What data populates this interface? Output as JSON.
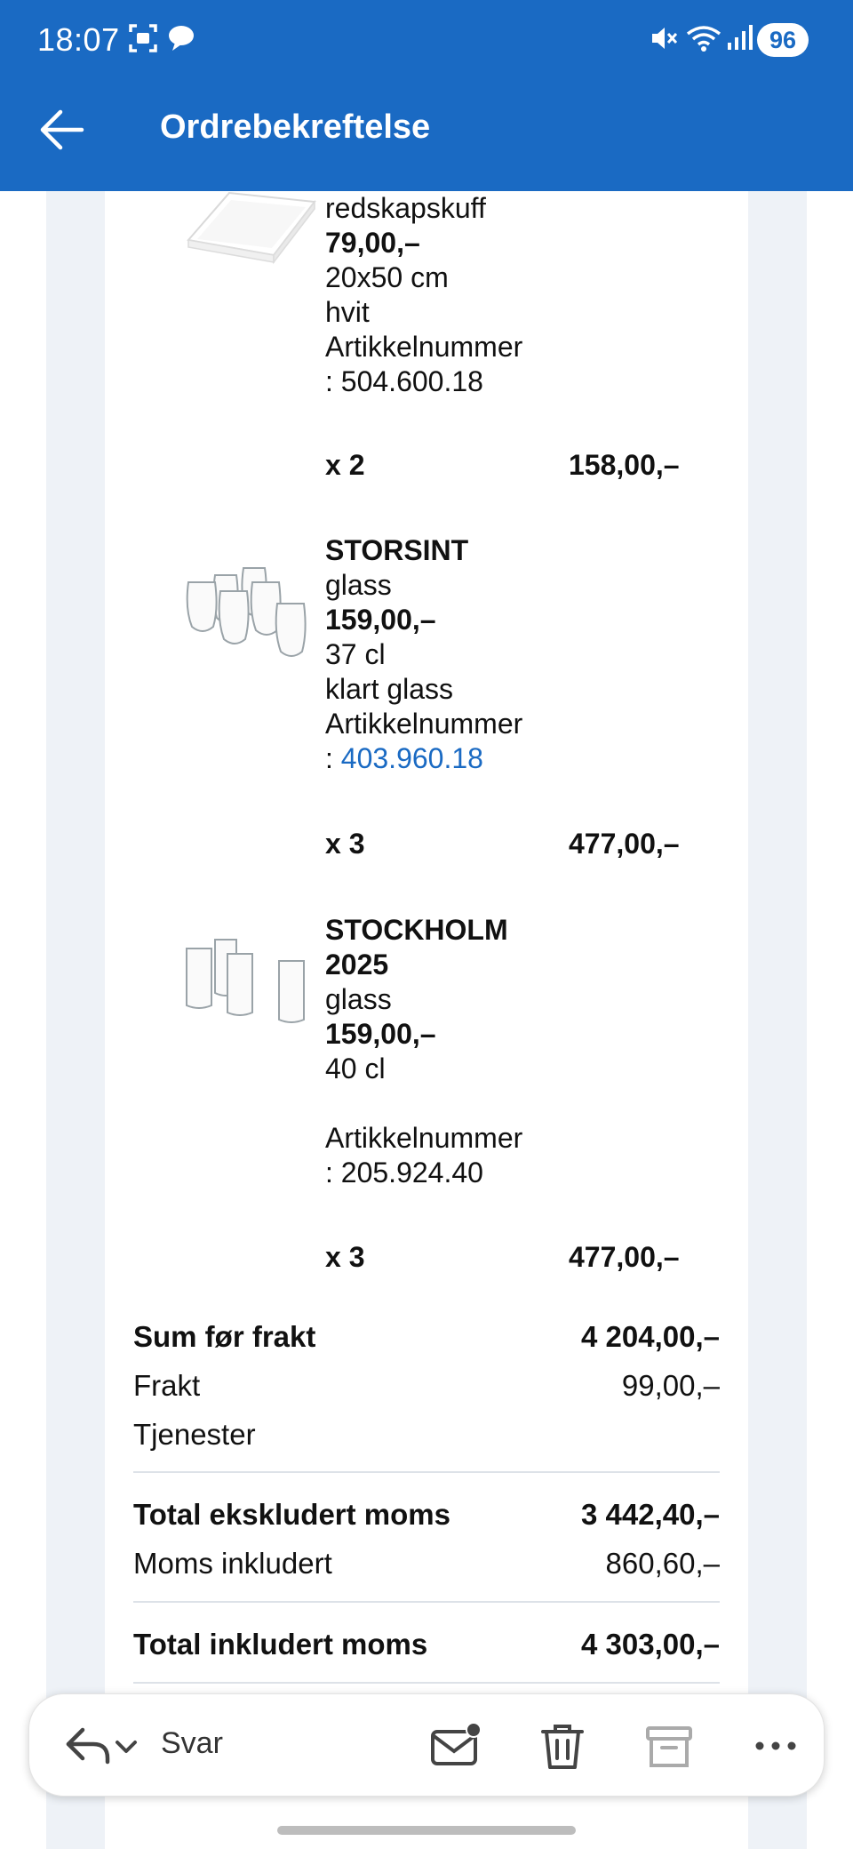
{
  "status": {
    "time": "18:07",
    "battery": "96"
  },
  "header": {
    "title": "Ordrebekreftelse"
  },
  "items": [
    {
      "name": "",
      "type": "redskapskuff",
      "price": "79,00,–",
      "spec1": "20x50 cm",
      "spec2": "hvit",
      "article_label": "Artikkelnummer",
      "article_prefix": ": ",
      "article_number": "504.600.18",
      "qty": "x 2",
      "total": "158,00,–"
    },
    {
      "name": "STORSINT",
      "type": "glass",
      "price": "159,00,–",
      "spec1": "37 cl",
      "spec2": "klart glass",
      "article_label": "Artikkelnummer",
      "article_prefix": ": ",
      "article_number": "403.960.18",
      "qty": "x 3",
      "total": "477,00,–"
    },
    {
      "name_line1": "STOCKHOLM",
      "name_line2": "2025",
      "type": "glass",
      "price": "159,00,–",
      "spec1": "40 cl",
      "article_label": "Artikkelnummer",
      "article_prefix": ": ",
      "article_number": "205.924.40",
      "qty": "x 3",
      "total": "477,00,–"
    }
  ],
  "summary": {
    "subtotal_label": "Sum før frakt",
    "subtotal_value": "4 204,00,–",
    "shipping_label": "Frakt",
    "shipping_value": "99,00,–",
    "services_label": "Tjenester",
    "ex_vat_label": "Total ekskludert moms",
    "ex_vat_value": "3 442,40,–",
    "vat_label": "Moms inkludert",
    "vat_value": "860,60,–",
    "total_label": "Total inkludert moms",
    "total_value": "4 303,00,–"
  },
  "actions": {
    "reply_label": "Svar"
  },
  "colors": {
    "brand_blue": "#1a6ac3",
    "side_band": "#eef2f7",
    "link": "#1a6ac3"
  }
}
